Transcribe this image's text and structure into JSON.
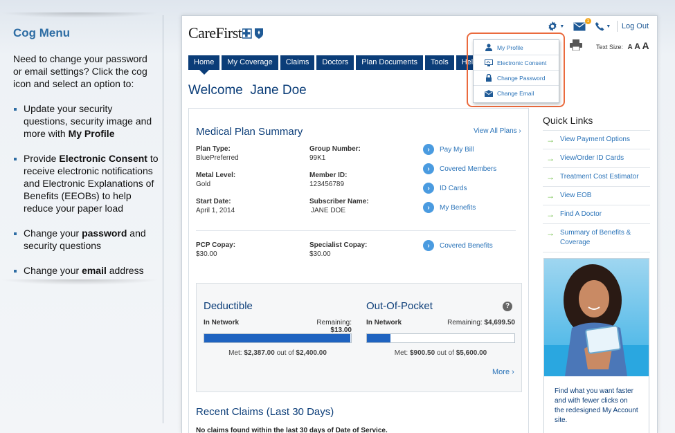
{
  "guide": {
    "title": "Cog Menu",
    "intro": "Need to change your password or email settings? Click the cog icon and select an option to:",
    "items": [
      {
        "before": "Update your security questions, security image and more with ",
        "bold": "My Profile",
        "after": ""
      },
      {
        "before": "Provide ",
        "bold": "Electronic Consent",
        "after": " to receive electronic notifications and Electronic Explanations of Benefits (EEOBs) to help reduce your paper load"
      },
      {
        "before": "Change your ",
        "bold": "password",
        "after": " and security questions"
      },
      {
        "before": "Change your ",
        "bold": "email",
        "after": " address"
      }
    ]
  },
  "header": {
    "logo": "CareFirst",
    "logout": "Log Out",
    "mail_badge": "1",
    "text_size_label": "Text Size:",
    "text_sizes": [
      "A",
      "A",
      "A"
    ]
  },
  "cog_menu": {
    "items": [
      {
        "label": "My Profile",
        "icon": "user-icon"
      },
      {
        "label": "Electronic Consent",
        "icon": "monitor-icon"
      },
      {
        "label": "Change Password",
        "icon": "lock-icon"
      },
      {
        "label": "Change Email",
        "icon": "email-icon"
      }
    ]
  },
  "nav": {
    "tabs": [
      "Home",
      "My Coverage",
      "Claims",
      "Doctors",
      "Plan Documents",
      "Tools",
      "Help"
    ]
  },
  "welcome": {
    "prefix": "Welcome",
    "name": "Jane Doe"
  },
  "plan_summary": {
    "title": "Medical Plan Summary",
    "view_all": "View All Plans",
    "plan_type_label": "Plan Type:",
    "plan_type": "BluePreferred",
    "group_number_label": "Group Number:",
    "group_number": "99K1",
    "metal_level_label": "Metal Level:",
    "metal_level": "Gold",
    "member_id_label": "Member ID:",
    "member_id": "123456789",
    "start_date_label": "Start Date:",
    "start_date": "April 1, 2014",
    "subscriber_label": "Subscriber Name:",
    "subscriber": "JANE DOE",
    "pcp_label": "PCP Copay:",
    "pcp": "$30.00",
    "specialist_label": "Specialist Copay:",
    "specialist": "$30.00",
    "links": [
      "Pay My Bill",
      "Covered Members",
      "ID Cards",
      "My Benefits"
    ],
    "covered_benefits": "Covered Benefits"
  },
  "deductible": {
    "title": "Deductible",
    "network": "In Network",
    "remaining_label": "Remaining:",
    "remaining": "$13.00",
    "met_label": "Met:",
    "met": "$2,387.00",
    "out_of": "out of",
    "total": "$2,400.00",
    "fraction": 0.9946
  },
  "oop": {
    "title": "Out-Of-Pocket",
    "network": "In Network",
    "remaining_label": "Remaining:",
    "remaining": "$4,699.50",
    "met_label": "Met:",
    "met": "$900.50",
    "out_of": "out of",
    "total": "$5,600.00",
    "fraction": 0.1608
  },
  "more_label": "More",
  "help_glyph": "?",
  "claims": {
    "title": "Recent Claims (Last 30 Days)",
    "empty": "No claims found within the last 30 days of Date of Service."
  },
  "quick_links": {
    "title": "Quick Links",
    "items": [
      "View Payment Options",
      "View/Order ID Cards",
      "Treatment Cost Estimator",
      "View EOB",
      "Find A Doctor",
      "Summary of Benefits & Coverage"
    ]
  },
  "promo": {
    "text": "Find what you want faster and with fewer clicks on the redesigned My Account site."
  },
  "colors": {
    "brand_navy": "#0b3d78",
    "link_blue": "#2a73b8",
    "bar_fill": "#1f63c0",
    "callout_orange": "#ea6a3d",
    "arrow_green": "#5ab52b"
  }
}
